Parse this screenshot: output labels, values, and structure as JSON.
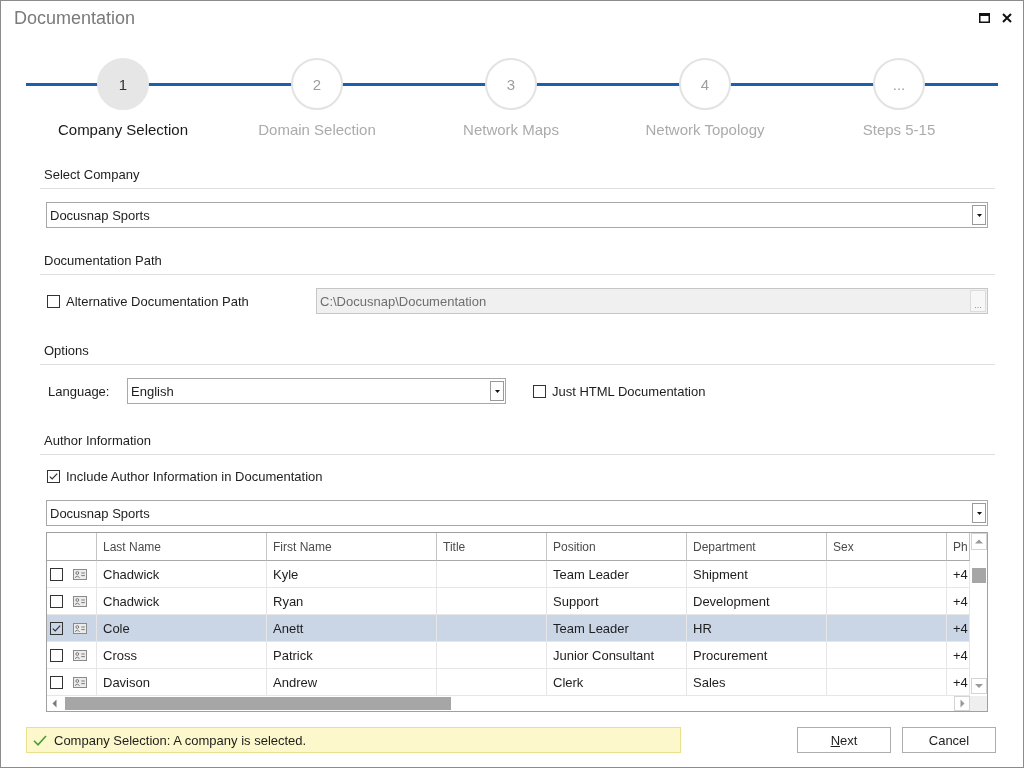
{
  "window": {
    "title": "Documentation"
  },
  "steps": [
    {
      "number": "1",
      "label": "Company Selection",
      "current": true
    },
    {
      "number": "2",
      "label": "Domain Selection",
      "current": false
    },
    {
      "number": "3",
      "label": "Network Maps",
      "current": false
    },
    {
      "number": "4",
      "label": "Network Topology",
      "current": false
    },
    {
      "number": "...",
      "label": "Steps 5-15",
      "current": false
    }
  ],
  "select_company": {
    "heading": "Select Company",
    "company": {
      "value": "Docusnap Sports"
    }
  },
  "documentation_path": {
    "heading": "Documentation Path",
    "alternative_path": {
      "label": "Alternative Documentation Path",
      "checked": false
    },
    "path_field": {
      "value": "C:\\Docusnap\\Documentation",
      "disabled": true,
      "browse_label": "..."
    }
  },
  "options": {
    "heading": "Options",
    "language": {
      "label": "Language:",
      "value": "English"
    },
    "just_html": {
      "label": "Just HTML Documentation",
      "checked": false
    }
  },
  "author_information": {
    "heading": "Author Information",
    "include_author": {
      "label": "Include Author Information in Documentation",
      "checked": true
    },
    "author_company": {
      "value": "Docusnap Sports"
    },
    "table": {
      "columns": [
        "Last Name",
        "First Name",
        "Title",
        "Position",
        "Department",
        "Sex",
        "Ph"
      ],
      "rows": [
        {
          "checked": false,
          "selected": false,
          "cells": [
            "Chadwick",
            "Kyle",
            null,
            "Team Leader",
            "Shipment",
            null,
            "+4"
          ]
        },
        {
          "checked": false,
          "selected": false,
          "cells": [
            "Chadwick",
            "Ryan",
            null,
            "Support",
            "Development",
            null,
            "+4"
          ]
        },
        {
          "checked": true,
          "selected": true,
          "cells": [
            "Cole",
            "Anett",
            null,
            "Team Leader",
            "HR",
            null,
            "+4"
          ]
        },
        {
          "checked": false,
          "selected": false,
          "cells": [
            "Cross",
            "Patrick",
            null,
            "Junior Consultant",
            "Procurement",
            null,
            "+4"
          ]
        },
        {
          "checked": false,
          "selected": false,
          "cells": [
            "Davison",
            "Andrew",
            null,
            "Clerk",
            "Sales",
            null,
            "+4"
          ]
        }
      ]
    }
  },
  "status_bar": {
    "kind": "success",
    "text": "Company Selection: A company is selected."
  },
  "buttons": [
    {
      "label": [
        {
          "text": "N",
          "underline": true
        },
        {
          "text": "ext",
          "underline": false
        }
      ]
    },
    {
      "label": [
        {
          "text": "Cancel",
          "underline": false
        }
      ]
    }
  ]
}
